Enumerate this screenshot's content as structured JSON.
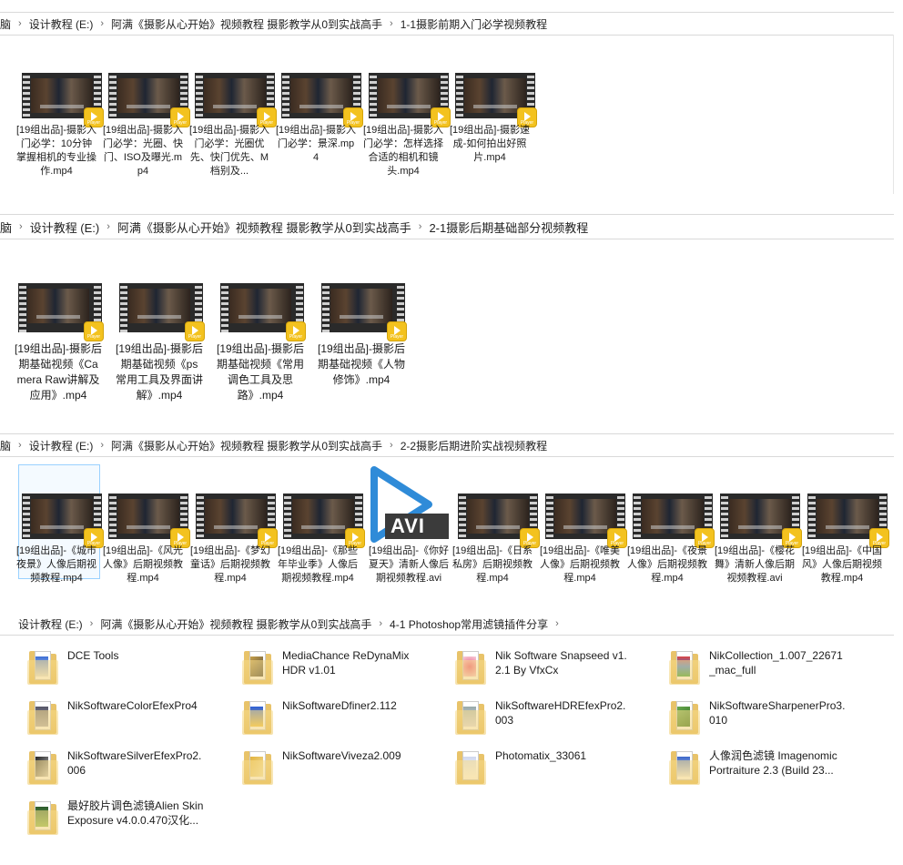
{
  "panels": [
    {
      "breadcrumb": [
        "脑",
        "设计教程 (E:)",
        "阿满《摄影从心开始》视频教程 摄影教学从0到实战高手",
        "1-1摄影前期入门必学视频教程"
      ],
      "files": [
        {
          "name": "[19组出品]-摄影入门必学：10分钟掌握相机的专业操作.mp4"
        },
        {
          "name": "[19组出品]-摄影入门必学：光圈、快门、ISO及曝光.mp4"
        },
        {
          "name": "[19组出品]-摄影入门必学：光圈优先、快门优先、M档别及..."
        },
        {
          "name": "[19组出品]-摄影入门必学：景深.mp4"
        },
        {
          "name": "[19组出品]-摄影入门必学：怎样选择合适的相机和镜头.mp4"
        },
        {
          "name": "[19组出品]-摄影速成-如何拍出好照片.mp4"
        }
      ]
    },
    {
      "breadcrumb": [
        "脑",
        "设计教程 (E:)",
        "阿满《摄影从心开始》视频教程 摄影教学从0到实战高手",
        "2-1摄影后期基础部分视频教程"
      ],
      "files": [
        {
          "name": "[19组出品]-摄影后期基础视频《Camera Raw讲解及应用》.mp4"
        },
        {
          "name": "[19组出品]-摄影后期基础视频《ps常用工具及界面讲解》.mp4"
        },
        {
          "name": "[19组出品]-摄影后期基础视频《常用调色工具及思路》.mp4"
        },
        {
          "name": "[19组出品]-摄影后期基础视频《人物修饰》.mp4"
        }
      ]
    },
    {
      "breadcrumb": [
        "脑",
        "设计教程 (E:)",
        "阿满《摄影从心开始》视频教程 摄影教学从0到实战高手",
        "2-2摄影后期进阶实战视频教程"
      ],
      "files": [
        {
          "name": "[19组出品]-《城市夜景》人像后期视频教程.mp4"
        },
        {
          "name": "[19组出品]-《风光人像》后期视频教程.mp4"
        },
        {
          "name": "[19组出品]-《梦幻童话》后期视频教程.mp4"
        },
        {
          "name": "[19组出品]-《那些年毕业季》人像后期视频教程.mp4"
        },
        {
          "name": "[19组出品]-《你好夏天》清新人像后期视频教程.avi",
          "type_label": "AVI"
        },
        {
          "name": "[19组出品]-《日系私房》后期视频教程.mp4"
        },
        {
          "name": "[19组出品]-《唯美人像》后期视频教程.mp4"
        },
        {
          "name": "[19组出品]-《夜景人像》后期视频教程.mp4"
        },
        {
          "name": "[19组出品]-《樱花舞》清新人像后期视频教程.avi"
        },
        {
          "name": "[19组出品]-《中国风》人像后期视频教程.mp4"
        }
      ]
    },
    {
      "breadcrumb": [
        "设计教程 (E:)",
        "阿满《摄影从心开始》视频教程 摄影教学从0到实战高手",
        "4-1 Photoshop常用滤镜插件分享"
      ],
      "folders": [
        {
          "name": "DCE Tools"
        },
        {
          "name": "MediaChance ReDynaMix HDR v1.01"
        },
        {
          "name": "Nik Software Snapseed v1.2.1 By VfxCx"
        },
        {
          "name": "NikCollection_1.007_22671_mac_full"
        },
        {
          "name": "NikSoftwareColorEfexPro4"
        },
        {
          "name": "NikSoftwareDfiner2.112"
        },
        {
          "name": "NikSoftwareHDREfexPro2.003"
        },
        {
          "name": "NikSoftwareSharpenerPro3.010"
        },
        {
          "name": "NikSoftwareSilverEfexPro2.006"
        },
        {
          "name": "NikSoftwareViveza2.009"
        },
        {
          "name": "Photomatix_33061"
        },
        {
          "name": "人像润色滤镜 Imagenomic Portraiture 2.3 (Build 23..."
        },
        {
          "name": "最好胶片调色滤镜Alien Skin Exposure v4.0.0.470汉化..."
        }
      ]
    }
  ],
  "player_badge": "Player",
  "icons": {
    "separator": "chevron-right-icon",
    "video": "video-file-icon",
    "folder": "folder-icon",
    "avi": "avi-play-icon"
  },
  "colors": {
    "avi_blue": "#2f8bd8",
    "badge_yellow": "#f3c21f",
    "folder_yellow": "#efcb6c",
    "selection": "#99d1ff"
  }
}
